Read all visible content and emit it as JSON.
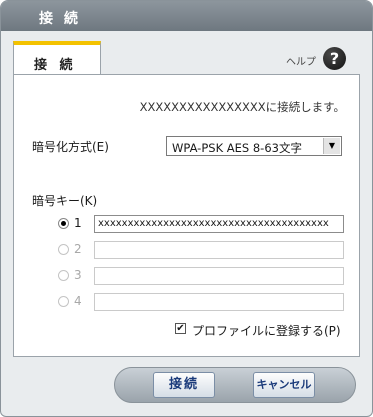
{
  "window": {
    "title": "接 続"
  },
  "tab": {
    "label": "接 続"
  },
  "help": {
    "label": "ヘルプ",
    "icon": "help-icon"
  },
  "main": {
    "connect_message": "XXXXXXXXXXXXXXXXに接続します。",
    "encryption": {
      "label": "暗号化方式(E)",
      "selected": "WPA-PSK AES 8-63文字"
    },
    "key": {
      "label": "暗号キー(K)",
      "rows": [
        {
          "number": "1",
          "value": "xxxxxxxxxxxxxxxxxxxxxxxxxxxxxxxxxxxxxxx",
          "checked": true,
          "enabled": true
        },
        {
          "number": "2",
          "value": "",
          "checked": false,
          "enabled": false
        },
        {
          "number": "3",
          "value": "",
          "checked": false,
          "enabled": false
        },
        {
          "number": "4",
          "value": "",
          "checked": false,
          "enabled": false
        }
      ]
    },
    "register_profile": {
      "label": "プロファイルに登録する(P)",
      "checked": true
    }
  },
  "buttons": {
    "connect": "接続",
    "cancel": "キャンセル"
  },
  "colors": {
    "accent_tab": "#f3c200",
    "titlebar": "#7d878e",
    "button_text": "#1a3a7a"
  }
}
